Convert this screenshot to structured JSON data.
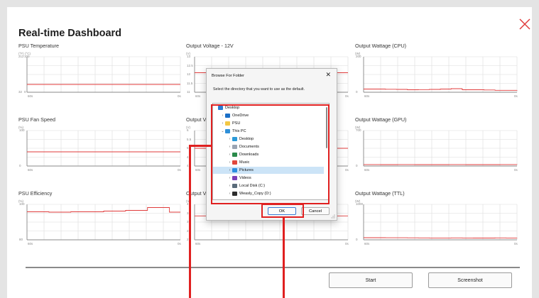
{
  "app": {
    "title": "Real-time Dashboard",
    "accent_color": "#e03b3b",
    "buttons": {
      "start": "Start",
      "screenshot": "Screenshot"
    }
  },
  "panels": [
    {
      "id": "psu-temperature",
      "title": "PSU Temperature",
      "units": [
        "(°F)",
        "(°C)"
      ],
      "y_left": [
        "212",
        "32"
      ],
      "y_right": [
        "100",
        "0"
      ],
      "x_start": "60s",
      "x_end": "0s",
      "chart_data": {
        "type": "line",
        "ylim": [
          0,
          100
        ],
        "values": [
          22,
          22,
          22,
          22,
          22,
          22,
          22,
          22,
          22,
          22
        ]
      }
    },
    {
      "id": "output-voltage-12v",
      "title": "Output Voltage - 12V",
      "units": [
        "(V)"
      ],
      "y_left": [
        "13",
        "12.5",
        "12",
        "11.5",
        "11"
      ],
      "y_right": [],
      "x_start": "60s",
      "x_end": "0s",
      "chart_data": {
        "type": "line",
        "ylim": [
          11,
          13
        ],
        "values": [
          12.1,
          12.1,
          12.1,
          12.1,
          12.1,
          12.1,
          12.1,
          12.1,
          12.1,
          12.1
        ]
      }
    },
    {
      "id": "output-wattage-cpu",
      "title": "Output Wattage (CPU)",
      "units": [
        "(W)"
      ],
      "y_left": [
        "200",
        "0"
      ],
      "y_right": [],
      "x_start": "60s",
      "x_end": "0s",
      "chart_data": {
        "type": "line",
        "ylim": [
          0,
          200
        ],
        "values": [
          18,
          18,
          17,
          16,
          14,
          15,
          16,
          18,
          20,
          14,
          14,
          13,
          11,
          11,
          12
        ]
      }
    },
    {
      "id": "psu-fan-speed",
      "title": "PSU Fan Speed",
      "units": [
        "(%)"
      ],
      "y_left": [
        "100",
        "0"
      ],
      "y_right": [],
      "x_start": "60s",
      "x_end": "0s",
      "chart_data": {
        "type": "line",
        "ylim": [
          0,
          100
        ],
        "values": [
          40,
          40,
          40,
          40,
          40,
          40,
          40,
          40,
          40,
          40
        ]
      }
    },
    {
      "id": "output-voltage-5v",
      "title": "Output Voltage - 5V",
      "units": [
        "(V)"
      ],
      "y_left": [
        "6",
        "5.5",
        "5",
        "4.5",
        "4"
      ],
      "y_right": [],
      "x_start": "60s",
      "x_end": "0s",
      "chart_data": {
        "type": "line",
        "ylim": [
          4,
          6
        ],
        "values": [
          5.0,
          5.0,
          5.0,
          5.0,
          5.0,
          5.0,
          5.0,
          5.0
        ]
      }
    },
    {
      "id": "output-wattage-gpu",
      "title": "Output Wattage (GPU)",
      "units": [
        "(W)"
      ],
      "y_left": [
        "700",
        "0"
      ],
      "y_right": [],
      "x_start": "60s",
      "x_end": "0s",
      "chart_data": {
        "type": "line",
        "ylim": [
          0,
          700
        ],
        "values": [
          30,
          28,
          30,
          28,
          28,
          30,
          28,
          28,
          30,
          28
        ]
      }
    },
    {
      "id": "psu-efficiency",
      "title": "PSU Efficiency",
      "units": [
        "(%)"
      ],
      "y_left": [
        "100",
        "80"
      ],
      "y_right": [],
      "x_start": "60s",
      "x_end": "0s",
      "chart_data": {
        "type": "line",
        "ylim": [
          80,
          100
        ],
        "values": [
          95.8,
          95.8,
          95.6,
          95.6,
          95.8,
          95.8,
          95.8,
          96.2,
          96.2,
          96.6,
          96.6,
          98.2,
          98.2,
          95.6,
          95.6
        ]
      }
    },
    {
      "id": "output-voltage-33v",
      "title": "Output Voltage - 3.3V",
      "units": [
        "(V)"
      ],
      "y_left": [
        "4",
        "3.5",
        "3",
        "2.5",
        "2"
      ],
      "y_right": [],
      "x_start": "60s",
      "x_end": "0s",
      "chart_data": {
        "type": "line",
        "ylim": [
          2,
          4
        ],
        "values": [
          3.35,
          3.35,
          3.35,
          3.35,
          3.35,
          3.35,
          3.35,
          3.35
        ]
      }
    },
    {
      "id": "output-wattage-ttl",
      "title": "Output Wattage (TTL)",
      "units": [
        "(W)"
      ],
      "y_left": [
        "1000",
        "0"
      ],
      "y_right": [],
      "x_start": "60s",
      "x_end": "0s",
      "chart_data": {
        "type": "line",
        "ylim": [
          0,
          1000
        ],
        "values": [
          60,
          60,
          58,
          58,
          56,
          55,
          52,
          52,
          54,
          52,
          50,
          50,
          54,
          52,
          50
        ]
      }
    }
  ],
  "dialog": {
    "title": "Browse For Folder",
    "description": "Select the directory that you want to use as the default.",
    "ok_label": "OK",
    "cancel_label": "Cancel",
    "close_glyph": "✕",
    "tree": [
      {
        "label": "Desktop",
        "icon": "desktop-icon",
        "color": "#2b7cd3",
        "level": 0,
        "chev": ""
      },
      {
        "label": "OneDrive",
        "icon": "cloud-icon",
        "color": "#1b6fc7",
        "level": 1,
        "chev": "›"
      },
      {
        "label": "PSU",
        "icon": "folder-icon",
        "color": "#f2c744",
        "level": 1,
        "chev": "›"
      },
      {
        "label": "This PC",
        "icon": "computer-icon",
        "color": "#2f8fd8",
        "level": 1,
        "chev": "⌄"
      },
      {
        "label": "Desktop",
        "icon": "desktop-icon",
        "color": "#2b9ad8",
        "level": 2,
        "chev": "›"
      },
      {
        "label": "Documents",
        "icon": "document-icon",
        "color": "#9aa4b2",
        "level": 2,
        "chev": "›"
      },
      {
        "label": "Downloads",
        "icon": "download-icon",
        "color": "#2a8a4a",
        "level": 2,
        "chev": "›"
      },
      {
        "label": "Music",
        "icon": "music-icon",
        "color": "#e0473c",
        "level": 2,
        "chev": "›"
      },
      {
        "label": "Pictures",
        "icon": "pictures-icon",
        "color": "#2c8fe0",
        "level": 2,
        "chev": "›",
        "selected": true
      },
      {
        "label": "Videos",
        "icon": "video-icon",
        "color": "#7b3fb8",
        "level": 2,
        "chev": "›"
      },
      {
        "label": "Local Disk (C:)",
        "icon": "drive-icon",
        "color": "#5a6b7a",
        "level": 2,
        "chev": "›"
      },
      {
        "label": "Weasly_Copy (D:)",
        "icon": "drive-icon",
        "color": "#2d2d2d",
        "level": 2,
        "chev": "›"
      }
    ]
  }
}
